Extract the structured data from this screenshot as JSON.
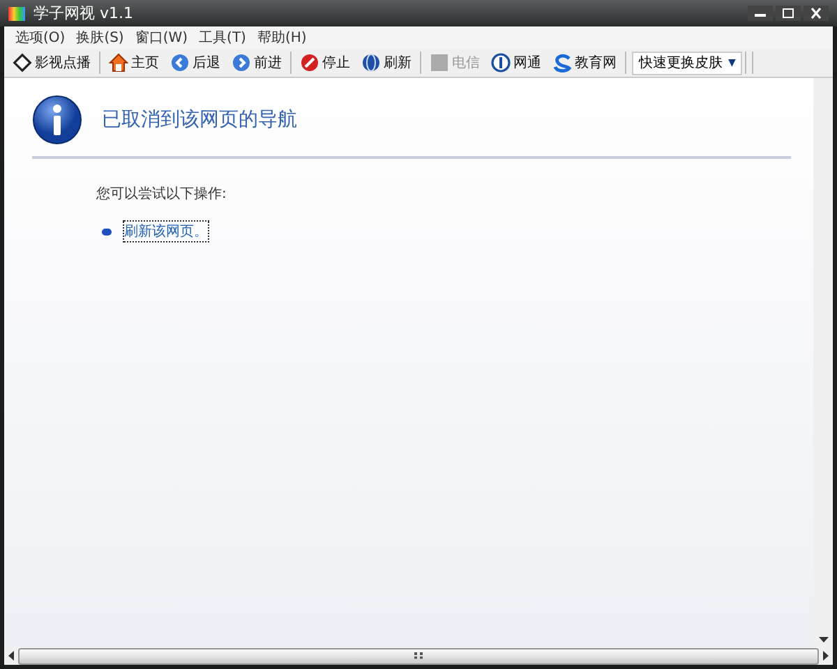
{
  "window": {
    "title": "学子网视 v1.1"
  },
  "menu": [
    "选项(O)",
    "换肤(S)",
    "窗口(W)",
    "工具(T)",
    "帮助(H)"
  ],
  "toolbar": [
    {
      "label": "影视点播",
      "kind": "diamond",
      "disabled": false
    },
    {
      "label": "主页",
      "kind": "home",
      "disabled": false
    },
    {
      "label": "后退",
      "kind": "back",
      "disabled": false
    },
    {
      "label": "前进",
      "kind": "forward",
      "disabled": false
    },
    {
      "label": "停止",
      "kind": "stop",
      "disabled": false
    },
    {
      "label": "刷新",
      "kind": "globe",
      "disabled": false
    },
    {
      "label": "电信",
      "kind": "square",
      "disabled": true
    },
    {
      "label": "网通",
      "kind": "netcom",
      "disabled": false
    },
    {
      "label": "教育网",
      "kind": "swirl",
      "disabled": false
    }
  ],
  "skin_dropdown": {
    "label": "快速更换皮肤",
    "arrow": "▼"
  },
  "page": {
    "heading": "已取消到该网页的导航",
    "hint": "您可以尝试以下操作:",
    "actions": [
      "刷新该网页。"
    ]
  }
}
